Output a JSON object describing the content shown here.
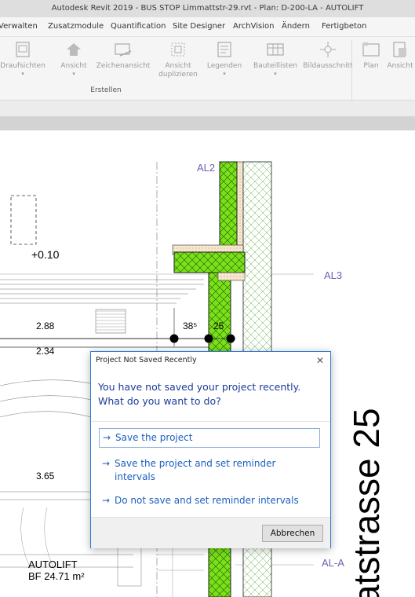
{
  "window": {
    "title": "Autodesk Revit 2019 - BUS STOP Limmattstr-29.rvt - Plan: D-200-LA - AUTOLIFT"
  },
  "menu": {
    "items": [
      "Verwalten",
      "Zusatzmodule",
      "Quantification",
      "Site Designer",
      "ArchVision",
      "Ändern",
      "Fertigbeton"
    ]
  },
  "ribbon": {
    "buttons": [
      {
        "label": "Draufsichten",
        "icon": "plan-views-icon"
      },
      {
        "label": "Ansicht",
        "icon": "house-view-icon"
      },
      {
        "label": "Zeichenansicht",
        "icon": "drafting-view-icon"
      },
      {
        "label": "Ansicht duplizieren",
        "icon": "duplicate-view-icon"
      },
      {
        "label": "Legenden",
        "icon": "legends-icon"
      },
      {
        "label": "Bauteillisten",
        "icon": "schedules-icon"
      },
      {
        "label": "Bildausschnitt",
        "icon": "scope-box-icon"
      },
      {
        "label": "Plan",
        "icon": "sheet-icon"
      },
      {
        "label": "Ansicht",
        "icon": "place-view-icon"
      }
    ],
    "group_label": "Erstellen"
  },
  "drawing": {
    "grid_al2": "AL2",
    "grid_al3": "AL3",
    "grid_ala": "AL-A",
    "level": "+0.10",
    "dim_288": "2.88",
    "dim_234": "2.34",
    "dim_38": "38⁵",
    "dim_25": "25",
    "dim_365": "3.65",
    "room_name": "AUTOLIFT",
    "room_area": "BF  24.71 m²",
    "street": "atstrasse 25"
  },
  "dialog": {
    "title": "Project Not Saved Recently",
    "close": "✕",
    "message_line1": "You have not saved your project recently.",
    "message_line2": "What do you want to do?",
    "options": [
      {
        "arrow": "→",
        "text": "Save the project"
      },
      {
        "arrow": "→",
        "text": "Save the project and set reminder",
        "text2": "intervals"
      },
      {
        "arrow": "→",
        "text": "Do not save and set reminder intervals"
      }
    ],
    "cancel": "Abbrechen"
  }
}
